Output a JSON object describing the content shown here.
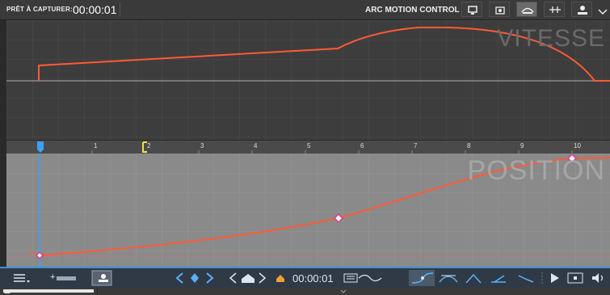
{
  "topbar": {
    "status_label": "PRÊT À CAPTURER:",
    "status_time": "00:00:01",
    "app_title": "ARC MOTION CONTROL",
    "buttons": [
      "monitor-icon",
      "camera-icon",
      "rig-icon",
      "timeline-icon",
      "motor-icon",
      "chevron-down-icon"
    ]
  },
  "speed_graph": {
    "watermark": "VITESSE"
  },
  "ruler": {
    "ticks": [
      "1",
      "2",
      "3",
      "4",
      "5",
      "6",
      "7",
      "8",
      "9",
      "10"
    ]
  },
  "position_graph": {
    "watermark": "POSITION",
    "start_label": "Tx"
  },
  "bottombar": {
    "time": "00:00:01"
  },
  "colors": {
    "curve": "#ff5a36",
    "keyframe": "#d63a8c",
    "playhead": "#3da0ff",
    "marker": "#f0e040",
    "accent": "#3d8fd6"
  }
}
